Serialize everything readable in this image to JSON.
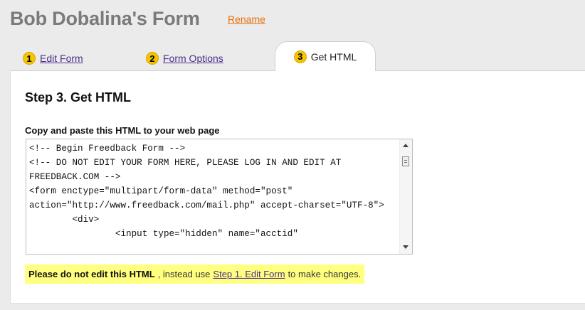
{
  "header": {
    "title": "Bob Dobalina's Form",
    "rename_label": "Rename"
  },
  "tabs": [
    {
      "number": "1",
      "label": "Edit Form",
      "active": false
    },
    {
      "number": "2",
      "label": "Form Options",
      "active": false
    },
    {
      "number": "3",
      "label": "Get HTML",
      "active": true
    }
  ],
  "main": {
    "heading": "Step 3. Get HTML",
    "copy_label": "Copy and paste this HTML to your web page",
    "code": "<!-- Begin Freedback Form -->\n<!-- DO NOT EDIT YOUR FORM HERE, PLEASE LOG IN AND EDIT AT FREEDBACK.COM -->\n<form enctype=\"multipart/form-data\" method=\"post\" action=\"http://www.freedback.com/mail.php\" accept-charset=\"UTF-8\">\n        <div>\n                <input type=\"hidden\" name=\"acctid\"",
    "notice": {
      "bold": "Please do not edit this HTML",
      "before_link": ", instead use",
      "link": "Step 1. Edit Form",
      "after_link": "to make changes."
    }
  },
  "colors": {
    "accent_link": "#e8700d",
    "tab_badge": "#f6c500",
    "notice_bg": "#ffff80",
    "link": "#4a2e8c"
  },
  "icons": {
    "scroll_up": "scroll-up-arrow-icon",
    "scroll_down": "scroll-down-arrow-icon"
  }
}
